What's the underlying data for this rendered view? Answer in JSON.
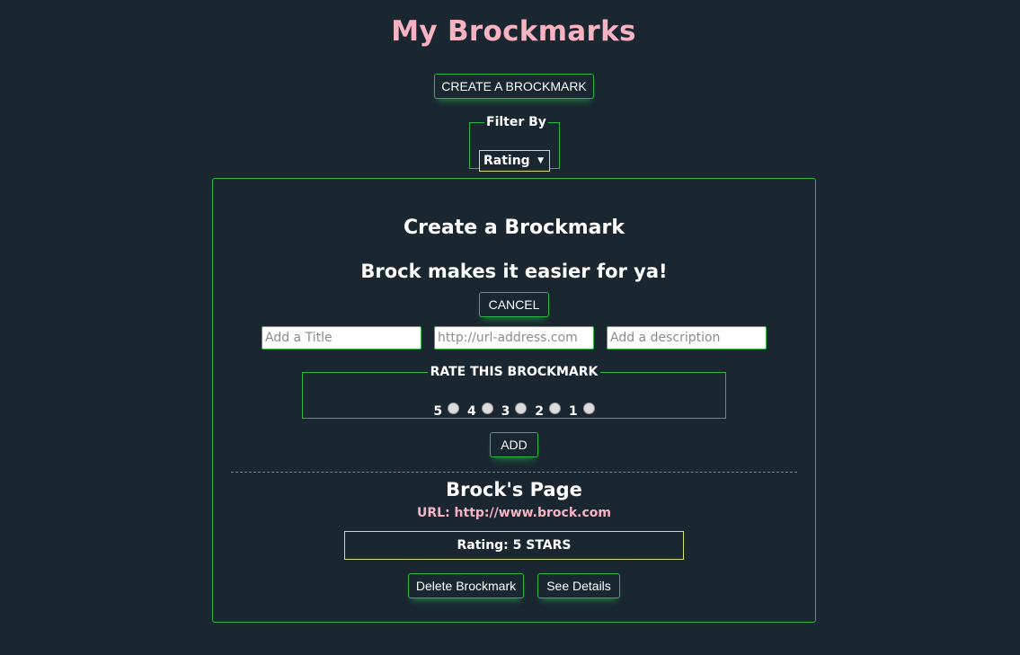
{
  "header": {
    "title": "My Brockmarks",
    "create_button": "CREATE A BROCKMARK"
  },
  "filter": {
    "legend": "Filter By",
    "selected": "Rating"
  },
  "form": {
    "title": "Create a Brockmark",
    "subtitle": "Brock makes it easier for ya!",
    "cancel_label": "CANCEL",
    "title_placeholder": "Add a Title",
    "url_placeholder": "http://url-address.com",
    "description_placeholder": "Add a description",
    "rating_legend": "RATE THIS BROCKMARK",
    "rating_options": [
      "5",
      "4",
      "3",
      "2",
      "1"
    ],
    "add_label": "ADD"
  },
  "bookmark": {
    "title": "Brock's Page",
    "url": "URL: http://www.brock.com",
    "rating": "Rating: 5 STARS",
    "delete_label": "Delete Brockmark",
    "details_label": "See Details"
  },
  "colors": {
    "background": "#1a2630",
    "accent_green": "#2bb84a",
    "accent_pink": "#f7b3c2",
    "accent_yellow": "#d8e26a"
  }
}
